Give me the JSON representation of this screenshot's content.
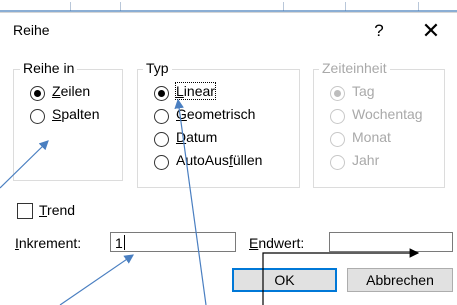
{
  "dialog": {
    "title": "Reihe",
    "help_label": "?",
    "close_label": "✕"
  },
  "series_in": {
    "legend": "Reihe in",
    "options": [
      {
        "label": "Zeilen",
        "accel": "Z",
        "rest": "eilen",
        "checked": true
      },
      {
        "label": "Spalten",
        "accel": "S",
        "rest": "palten",
        "checked": false
      }
    ]
  },
  "type": {
    "legend": "Typ",
    "options": [
      {
        "label": "Linear",
        "pre": "",
        "accel": "L",
        "rest": "inear",
        "checked": true
      },
      {
        "label": "Geometrisch",
        "pre": "",
        "accel": "G",
        "rest": "eometrisch",
        "checked": false
      },
      {
        "label": "Datum",
        "pre": "",
        "accel": "D",
        "rest": "atum",
        "checked": false
      },
      {
        "label": "AutoAusfüllen",
        "pre": "AutoAus",
        "accel": "f",
        "rest": "üllen",
        "checked": false
      }
    ]
  },
  "date_unit": {
    "legend": "Zeiteinheit",
    "options": [
      {
        "label": "Tag",
        "checked": true
      },
      {
        "label": "Wochentag",
        "checked": false
      },
      {
        "label": "Monat",
        "checked": false
      },
      {
        "label": "Jahr",
        "checked": false
      }
    ]
  },
  "trend": {
    "accel": "T",
    "rest": "rend",
    "checked": false
  },
  "step": {
    "accel": "I",
    "rest": "nkrement:",
    "value": "1"
  },
  "stop": {
    "accel": "E",
    "rest": "ndwert:",
    "value": ""
  },
  "buttons": {
    "ok": "OK",
    "cancel": "Abbrechen"
  },
  "colors": {
    "accent": "#0078d7",
    "annotation_arrow": "#4a7fc1",
    "disabled_text": "#a9a9a9"
  }
}
